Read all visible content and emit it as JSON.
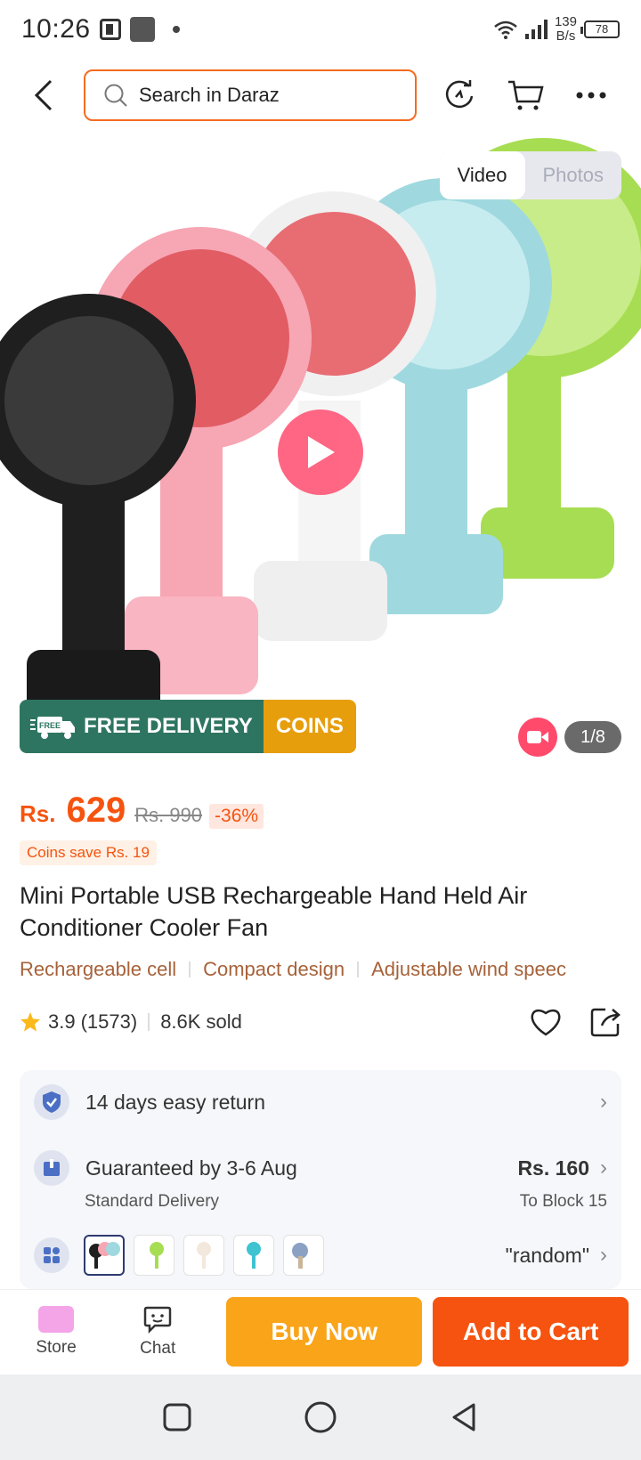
{
  "status_bar": {
    "time": "10:26",
    "speed_value": "139",
    "speed_unit": "B/s",
    "battery": "78"
  },
  "header": {
    "search_placeholder": "Search in Daraz"
  },
  "gallery": {
    "tabs": [
      "Video",
      "Photos"
    ],
    "active_tab": "Video",
    "free_delivery_label": "FREE DELIVERY",
    "free_tag": "FREE",
    "coins_label": "COINS",
    "counter": "1/8",
    "fan_colors": [
      "#1f1f1f",
      "#f7a6b4",
      "#ffffff",
      "#9fd9df",
      "#a7dd52"
    ]
  },
  "price": {
    "currency": "Rs.",
    "current": "629",
    "original": "Rs. 990",
    "discount": "-36%",
    "coins_save": "Coins save Rs. 19"
  },
  "product": {
    "title": "Mini Portable USB Rechargeable Hand Held Air Conditioner Cooler Fan",
    "features": [
      "Rechargeable cell",
      "Compact design",
      "Adjustable wind speec"
    ],
    "rating": "3.9",
    "rating_count": "(1573)",
    "sold": "8.6K sold"
  },
  "info": {
    "return_text": "14 days easy return",
    "delivery_title": "Guaranteed by 3-6 Aug",
    "delivery_price": "Rs. 160",
    "delivery_type": "Standard Delivery",
    "delivery_to": "To Block 15",
    "variant_value": "\"random\""
  },
  "bottom_bar": {
    "store_label": "Store",
    "chat_label": "Chat",
    "buy_now": "Buy Now",
    "add_to_cart": "Add to Cart"
  },
  "colors": {
    "brand_orange": "#f5530f",
    "buy_now": "#faa41a",
    "free_delivery_green": "#2e7561",
    "coins_gold": "#e79e0c",
    "play_pink": "#ff5a7a"
  }
}
